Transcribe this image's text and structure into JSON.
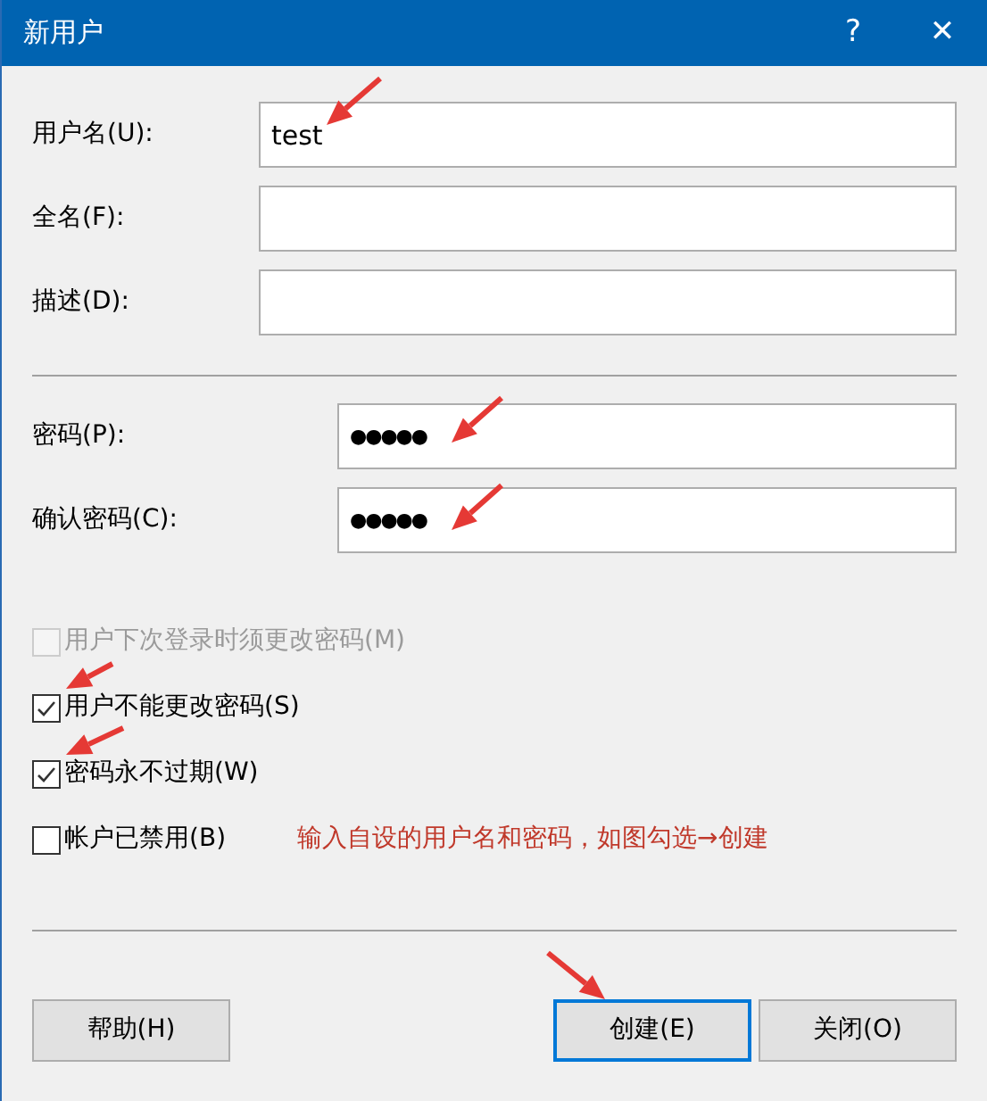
{
  "window": {
    "title": "新用户",
    "buttons": [
      "?",
      "✕"
    ]
  },
  "fields": [
    {
      "label": "用户名(U):",
      "value": "test"
    },
    {
      "label": "全名(F):"
    },
    {
      "label": "描述(D):"
    }
  ],
  "password_fields": [
    {
      "label": "密码(P):",
      "value": "●●●●●"
    },
    {
      "label": "确认密码(C):",
      "value": "●●●●●"
    }
  ],
  "checkboxes": [
    {
      "label": "用户下次登录时须更改密码(M)",
      "checked": false,
      "disabled": true
    },
    {
      "label": "用户不能更改密码(S)",
      "checked": true,
      "disabled": false
    },
    {
      "label": "密码永不过期(W)",
      "checked": true,
      "disabled": false
    },
    {
      "label": "帐户已禁用(B)",
      "checked": false,
      "disabled": false
    }
  ],
  "annotation": "输入自设的用户名和密码，如图勾选→创建",
  "buttons": [
    {
      "label": "帮助(H)",
      "default": false
    },
    {
      "label": "创建(E)",
      "default": true
    },
    {
      "label": "关闭(O)",
      "default": false
    }
  ]
}
